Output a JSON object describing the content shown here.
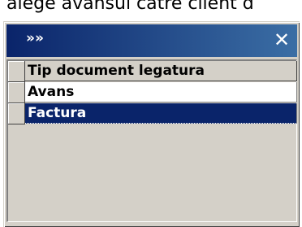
{
  "background_text": "alege avansul catre client d",
  "dialog": {
    "title_icon": "double-chevron-right-icon",
    "close_label": "✕"
  },
  "grid": {
    "column_header": "Tip document legatura",
    "rows": [
      {
        "value": "Avans",
        "selected": false
      },
      {
        "value": "Factura",
        "selected": true
      }
    ]
  },
  "colors": {
    "titlebar": "#0a246a",
    "selection": "#0a246a",
    "face": "#d4d0c8"
  }
}
